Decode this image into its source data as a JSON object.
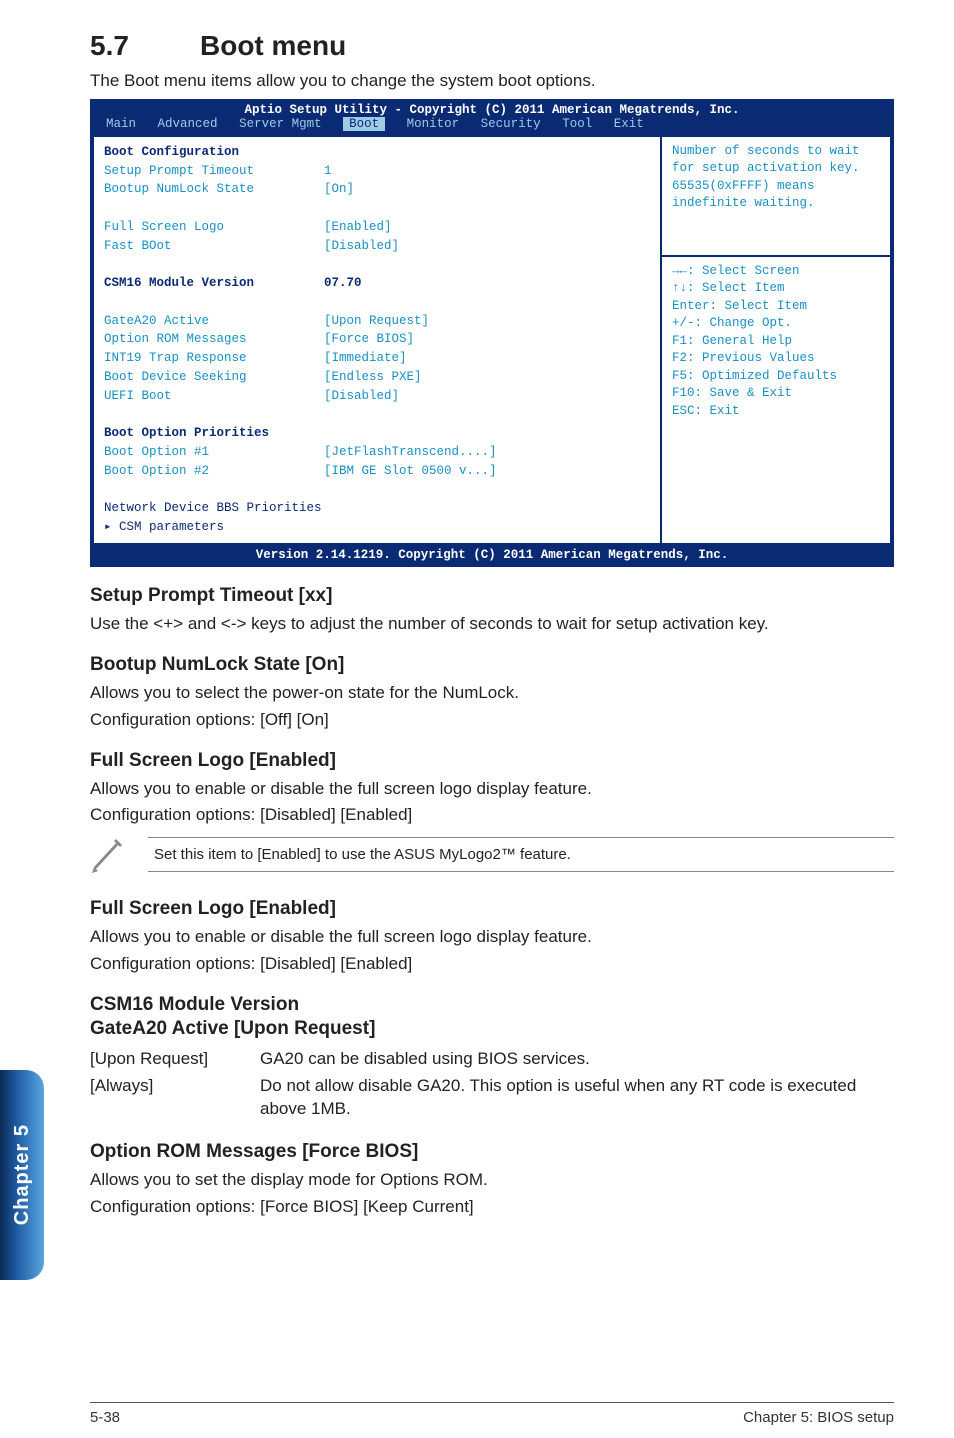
{
  "section": {
    "number": "5.7",
    "title": "Boot menu"
  },
  "intro": "The Boot menu items allow you to change the system boot options.",
  "bios": {
    "header": "Aptio Setup Utility - Copyright (C) 2011 American Megatrends, Inc.",
    "menu": {
      "items": [
        "Main",
        "Advanced",
        "Server Mgmt",
        "Boot",
        "Monitor",
        "Security",
        "Tool",
        "Exit"
      ],
      "selected": "Boot"
    },
    "left": {
      "heading1": "Boot Configuration",
      "rows1": [
        {
          "k": "Setup Prompt Timeout",
          "v": "1",
          "hl": true
        },
        {
          "k": "Bootup NumLock State",
          "v": "[On]",
          "hl": true
        },
        {
          "k": "",
          "v": ""
        },
        {
          "k": "Full Screen Logo",
          "v": "[Enabled]",
          "hl": true
        },
        {
          "k": "Fast BOot",
          "v": "[Disabled]",
          "hl": true
        }
      ],
      "csm": {
        "k": "CSM16 Module Version",
        "v": "07.70"
      },
      "rows2": [
        {
          "k": "GateA20 Active",
          "v": "[Upon Request]",
          "hl": true
        },
        {
          "k": "Option ROM Messages",
          "v": "[Force BIOS]",
          "hl": true
        },
        {
          "k": "INT19 Trap Response",
          "v": "[Immediate]",
          "hl": true
        },
        {
          "k": "Boot Device Seeking",
          "v": "[Endless PXE]",
          "hl": true
        },
        {
          "k": "UEFI Boot",
          "v": "[Disabled]",
          "hl": true
        }
      ],
      "heading2": "Boot Option Priorities",
      "rows3": [
        {
          "k": "Boot Option #1",
          "v": "[JetFlashTranscend....]",
          "hl": true
        },
        {
          "k": "Boot Option #2",
          "v": "[IBM GE Slot 0500 v...]",
          "hl": true
        }
      ],
      "net": "Network Device BBS Priorities",
      "csmparam": "CSM parameters"
    },
    "right": {
      "help": "Number of seconds to wait for setup activation key.\n65535(0xFFFF) means indefinite waiting.",
      "keys": [
        "→←: Select Screen",
        "↑↓:  Select Item",
        "Enter: Select Item",
        "+/-: Change Opt.",
        "F1: General Help",
        "F2: Previous Values",
        "F5: Optimized Defaults",
        "F10: Save & Exit",
        "ESC: Exit"
      ]
    },
    "footer": "Version 2.14.1219. Copyright (C) 2011 American Megatrends, Inc."
  },
  "s1": {
    "h": "Setup Prompt Timeout [xx]",
    "p": "Use the <+> and <-> keys to adjust the number of seconds to wait for setup activation key."
  },
  "s2": {
    "h": "Bootup NumLock State [On]",
    "p1": "Allows you to select the power-on state for the NumLock.",
    "p2": "Configuration options: [Off] [On]"
  },
  "s3": {
    "h": "Full Screen Logo [Enabled]",
    "p1": "Allows you to enable or disable the full screen logo display feature.",
    "p2": "Configuration options: [Disabled] [Enabled]"
  },
  "note": "Set this item to [Enabled] to use the ASUS MyLogo2™ feature.",
  "s4": {
    "h": "Full Screen Logo [Enabled]",
    "p1": "Allows you to enable or disable the full screen logo display feature.",
    "p2": "Configuration options: [Disabled] [Enabled]"
  },
  "s5": {
    "h1": "CSM16 Module Version",
    "h2": "GateA20 Active [Upon Request]",
    "row1k": "[Upon Request]",
    "row1v": "GA20 can be disabled using BIOS services.",
    "row2k": "[Always]",
    "row2v": "Do not allow disable GA20. This option is useful when any RT code is executed above 1MB."
  },
  "s6": {
    "h": "Option ROM Messages [Force BIOS]",
    "p1": "Allows you to set the display mode for Options ROM.",
    "p2": "Configuration options: [Force BIOS] [Keep Current]"
  },
  "sidetab": "Chapter 5",
  "footer": {
    "left": "5-38",
    "right": "Chapter 5: BIOS setup"
  }
}
